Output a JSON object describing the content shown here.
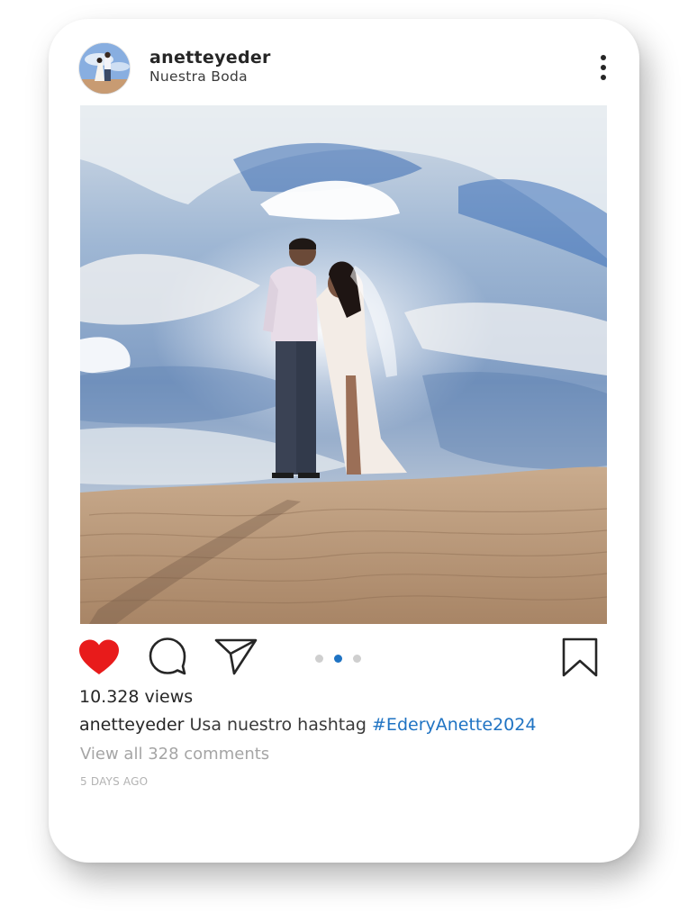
{
  "post": {
    "username": "anetteyeder",
    "subtitle": "Nuestra Boda",
    "views": "10.328 views",
    "caption": {
      "user": "anetteyeder",
      "text": "Usa nuestro hashtag",
      "hashtag": "#EderyAnette2024"
    },
    "view_comments": "View all 328 comments",
    "age": "5 DAYS AGO"
  },
  "icons": {
    "more": "vertical-dots-icon",
    "like": "heart-icon",
    "comment": "comment-bubble-icon",
    "share": "paper-plane-icon",
    "save": "bookmark-icon"
  },
  "carousel": {
    "total": 3,
    "active_index": 1
  },
  "colors": {
    "like": "#e81b1b",
    "link": "#1f73c3",
    "muted": "#a5a5a5"
  }
}
